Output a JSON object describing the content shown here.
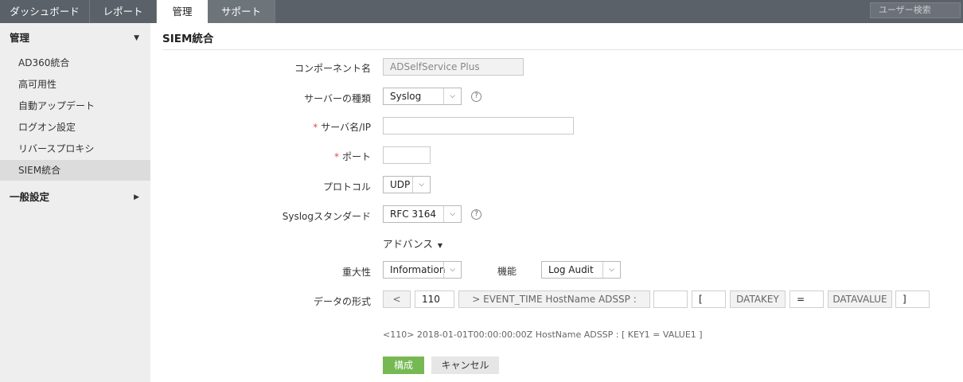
{
  "topnav": {
    "tabs": [
      {
        "label": "ダッシュボード"
      },
      {
        "label": "レポート"
      },
      {
        "label": "管理"
      },
      {
        "label": "サポート"
      }
    ],
    "search_placeholder": "ユーザー検索"
  },
  "sidebar": {
    "section1": "管理",
    "items": [
      {
        "label": "AD360統合"
      },
      {
        "label": "高可用性"
      },
      {
        "label": "自動アップデート"
      },
      {
        "label": "ログオン設定"
      },
      {
        "label": "リバースプロキシ"
      },
      {
        "label": "SIEM統合"
      }
    ],
    "section2": "一般設定"
  },
  "page": {
    "title": "SIEM統合"
  },
  "form": {
    "component_label": "コンポーネント名",
    "component_value": "ADSelfService Plus",
    "server_type_label": "サーバーの種類",
    "server_type_value": "Syslog",
    "server_name_label": "サーバ名/IP",
    "server_name_value": "",
    "port_label": "ポート",
    "port_value": "",
    "protocol_label": "プロトコル",
    "protocol_value": "UDP",
    "standard_label": "Syslogスタンダード",
    "standard_value": "RFC 3164",
    "advanced_label": "アドバンス",
    "severity_label": "重大性",
    "severity_value": "Information",
    "feature_label": "機能",
    "feature_value": "Log Audit",
    "format_label": "データの形式",
    "format": {
      "open": "<",
      "priority": "110",
      "fixed": "> EVENT_TIME HostName ADSSP :",
      "custom": "",
      "bracket_open": "[",
      "datakey": "DATAKEY",
      "equals": "=",
      "datavalue": "DATAVALUE",
      "bracket_close": "]"
    },
    "preview": "<110> 2018-01-01T00:00:00:00Z HostName ADSSP : [ KEY1 = VALUE1 ]",
    "required_mark": "*",
    "help_glyph": "?"
  },
  "buttons": {
    "submit": "構成",
    "cancel": "キャンセル"
  },
  "colors": {
    "topbar": "#5a6168",
    "sidebar_bg": "#eeeeee",
    "primary_button": "#76b852",
    "required": "#d9534f"
  }
}
